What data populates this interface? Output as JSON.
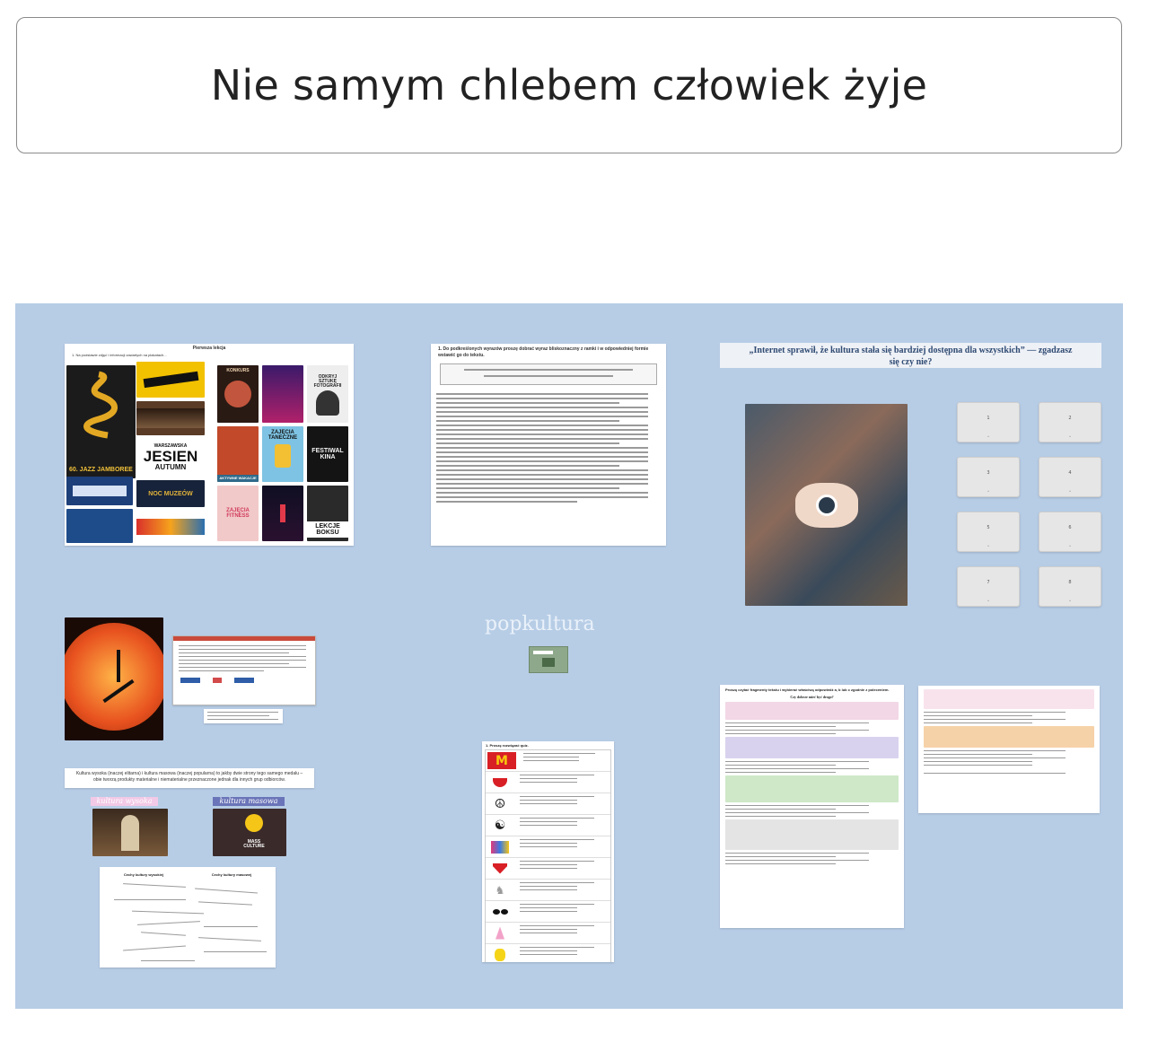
{
  "title": "Nie samym chlebem człowiek żyje",
  "board": {
    "popkultura_label": "popkultura",
    "card1": {
      "heading": "Pierwsza lekcja",
      "task": "1. Na podstawie zdjęć i informacji zawartych na plakatach...",
      "posters": {
        "jazz": "60. JAZZ JAMBOREE",
        "jesien": "JESIEN",
        "jesien_sub": "WARSZAWSKA",
        "jesien_foot": "AUTUMN",
        "noc": "NOC MUZEÓW",
        "konkurs": "KONKURS",
        "odkryj": "ODKRYJ SZTUKĘ FOTOGRAFII",
        "zajecia": "ZAJĘCIA TANECZNE",
        "festiwal": "FESTIWAL KINA",
        "aktywne": "AKTYWNE WAKACJE",
        "fitness": "ZAJĘCIA FITNESS",
        "lekcje": "LEKCJE BOKSU"
      }
    },
    "card2": {
      "task": "1. Do podkreślonych wyrazów proszę dobrać wyraz bliskoznaczny z ramki i w odpowiedniej formie wstawić go do tekstu."
    },
    "card3": {
      "quote": "„Internet sprawił, że kultura stała się bardziej dostępna dla wszystkich” — zgadzasz się czy nie?",
      "slots": [
        "1",
        "2",
        "3",
        "4",
        "5",
        "6",
        "7",
        "8"
      ]
    },
    "card4": {
      "heading": "Kultura wysoka (inaczej elitarna) i kultura masowa (inaczej popularna) to jakby dwie strony tego samego medalu – obie tworzą produkty materialne i niematerialne przeznaczone jednak dla innych grup odbiorców.",
      "label_high": "kultura wysoka",
      "label_mass": "kultura masowa",
      "mass_icon": "MASS CULTURE"
    },
    "card5": {
      "col1": "Cechy kultury wysokiej",
      "col2": "Cechy kultury masowej"
    },
    "card6": {
      "heading": "1. Proszę rozwiązać quiz."
    },
    "card7": {
      "heading": "Proszę czytać fragmenty tekstu i wybierać właściwą odpowiedź a, b lub c zgodnie z poleceniem.",
      "subtitle": "Czy dobrze mieć być drogo?"
    },
    "colors": {
      "board": "#b7cde6",
      "pink": "#f2d7e6",
      "purple": "#d9d2ee",
      "green": "#cfe8c8",
      "orange": "#f6d2a8",
      "mc_yellow": "#f7c80f",
      "mc_red": "#d81f25"
    }
  }
}
